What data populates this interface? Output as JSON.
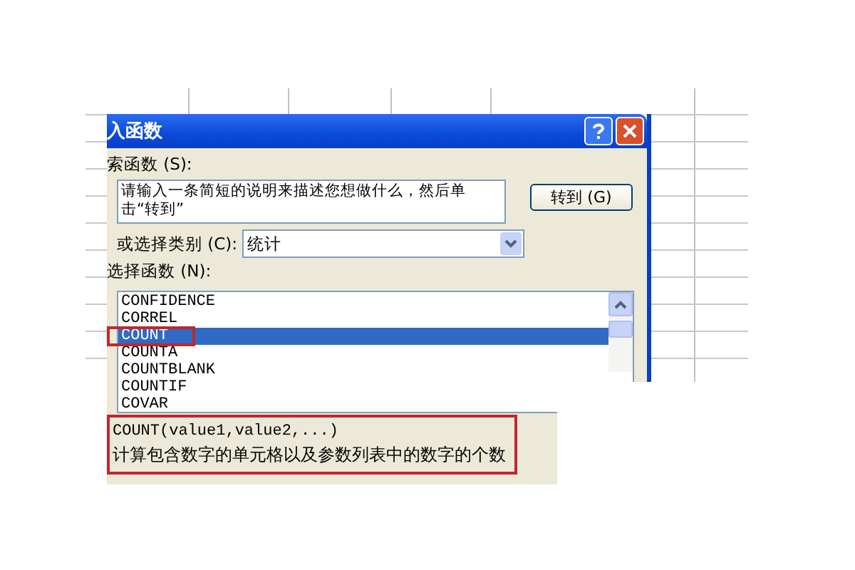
{
  "dialog": {
    "title": "入函数",
    "search_label": "索函数 (S):",
    "search_field": {
      "value": "请输入一条简短的说明来描述您想做什么，然后单击“转到”"
    },
    "go_button": "转到 (G)",
    "category_label": "或选择类别 (C):",
    "category": {
      "value": "统计"
    },
    "function_label": "选择函数 (N):",
    "functions": [
      {
        "name": "CONFIDENCE",
        "selected": false,
        "highlighted": false
      },
      {
        "name": "CORREL",
        "selected": false,
        "highlighted": false
      },
      {
        "name": "COUNT",
        "selected": true,
        "highlighted": true
      },
      {
        "name": "COUNTA",
        "selected": false,
        "highlighted": false
      },
      {
        "name": "COUNTBLANK",
        "selected": false,
        "highlighted": false
      },
      {
        "name": "COUNTIF",
        "selected": false,
        "highlighted": false
      },
      {
        "name": "COVAR",
        "selected": false,
        "highlighted": false
      }
    ],
    "syntax": "COUNT(value1,value2,...)",
    "description": "计算包含数字的单元格以及参数列表中的数字的个数",
    "description_highlighted": true
  }
}
